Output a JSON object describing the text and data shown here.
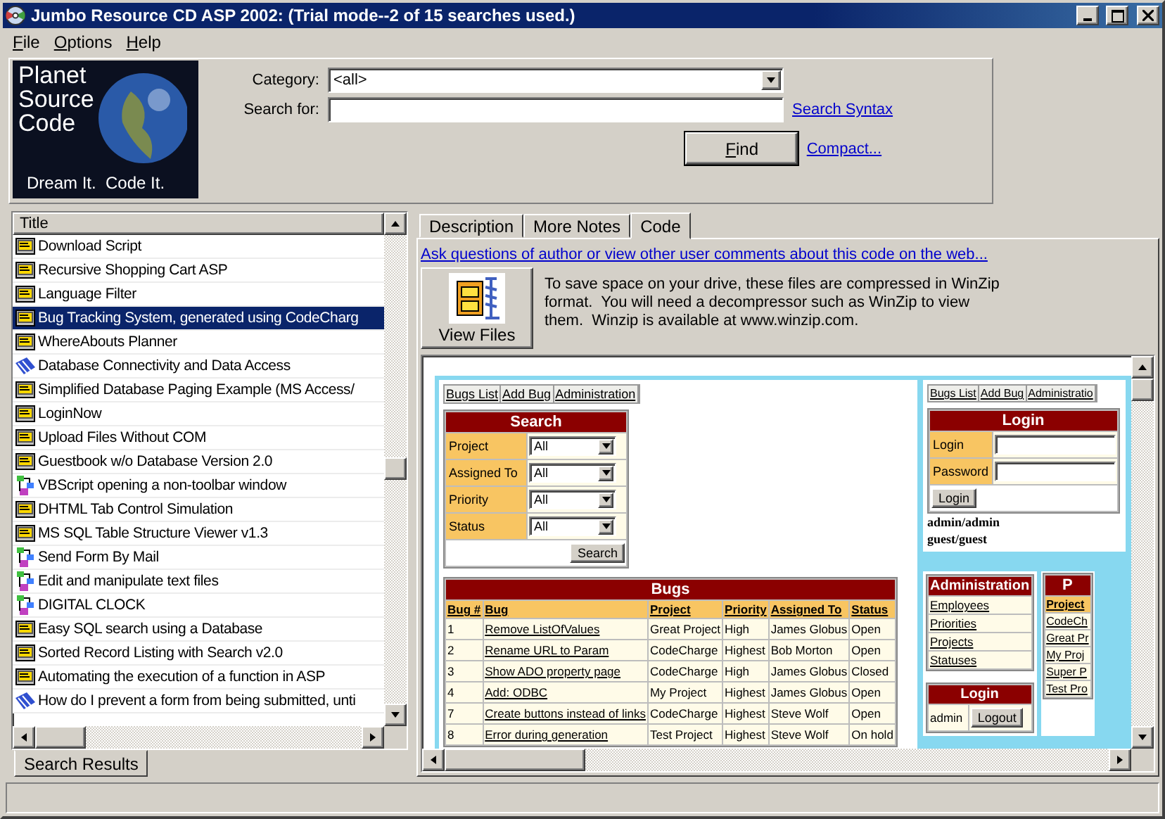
{
  "window": {
    "title": "Jumbo Resource CD ASP 2002: (Trial mode--2 of 15 searches used.)"
  },
  "menu": [
    {
      "label": "File"
    },
    {
      "label": "Options"
    },
    {
      "label": "Help"
    }
  ],
  "logo": {
    "lines": [
      "Planet",
      "Source",
      "Code"
    ],
    "tagline": "Dream It.  Code It."
  },
  "search": {
    "category_label": "Category:",
    "category_value": "<all>",
    "search_label": "Search for:",
    "syntax_link": "Search Syntax",
    "find_button": "Find",
    "compact_link": "Compact..."
  },
  "results": {
    "column": "Title",
    "items": [
      {
        "title": "Download Script",
        "kind": "sql",
        "selected": false
      },
      {
        "title": "Recursive Shopping Cart ASP",
        "kind": "sql",
        "selected": false
      },
      {
        "title": "Language Filter",
        "kind": "sql",
        "selected": false
      },
      {
        "title": "Bug Tracking System, generated using CodeCharg",
        "kind": "sql",
        "selected": true
      },
      {
        "title": "WhereAbouts Planner",
        "kind": "sql",
        "selected": false
      },
      {
        "title": "Database Connectivity and Data Access",
        "kind": "connect",
        "selected": false
      },
      {
        "title": "Simplified Database Paging Example (MS Access/",
        "kind": "sql",
        "selected": false
      },
      {
        "title": "LoginNow",
        "kind": "sql",
        "selected": false
      },
      {
        "title": "Upload Files Without COM",
        "kind": "sql",
        "selected": false
      },
      {
        "title": "Guestbook w/o Database Version 2.0",
        "kind": "sql",
        "selected": false
      },
      {
        "title": "VBScript opening a non-toolbar window",
        "kind": "diagram",
        "selected": false
      },
      {
        "title": "DHTML Tab Control Simulation",
        "kind": "sql",
        "selected": false
      },
      {
        "title": "MS SQL Table Structure Viewer v1.3",
        "kind": "sql",
        "selected": false
      },
      {
        "title": "Send Form By Mail",
        "kind": "diagram",
        "selected": false
      },
      {
        "title": "Edit and manipulate text files",
        "kind": "diagram",
        "selected": false
      },
      {
        "title": "DIGITAL CLOCK",
        "kind": "diagram",
        "selected": false
      },
      {
        "title": "Easy SQL search using a Database",
        "kind": "sql",
        "selected": false
      },
      {
        "title": "Sorted Record Listing with Search v2.0",
        "kind": "sql",
        "selected": false
      },
      {
        "title": "Automating the execution of a function in ASP",
        "kind": "sql",
        "selected": false
      },
      {
        "title": "How do I prevent a form from being submitted, unti",
        "kind": "connect",
        "selected": false
      }
    ]
  },
  "left_tabs": [
    {
      "label": "Search Results",
      "selected": true
    }
  ],
  "detail_tabs": [
    {
      "label": "Description",
      "selected": false
    },
    {
      "label": "More Notes",
      "selected": false
    },
    {
      "label": "Code",
      "selected": true
    }
  ],
  "web_link": "Ask questions of author or view other user comments about this code on the web...",
  "view_files_button": "View Files",
  "zip_note": "To save space on your drive, these files are compressed in WinZip format.  You will need a decompressor such as WinZip to view them.  Winzip is available at www.winzip.com.",
  "preview": {
    "nav": [
      "Bugs List",
      "Add Bug",
      "Administration"
    ],
    "search_form": {
      "title": "Search",
      "fields": [
        {
          "label": "Project",
          "value": "All"
        },
        {
          "label": "Assigned To",
          "value": "All"
        },
        {
          "label": "Priority",
          "value": "All"
        },
        {
          "label": "Status",
          "value": "All"
        }
      ],
      "button": "Search"
    },
    "bugs": {
      "title": "Bugs",
      "columns": [
        "Bug #",
        "Bug",
        "Project",
        "Priority",
        "Assigned To",
        "Status"
      ],
      "rows": [
        [
          "1",
          "Remove ListOfValues",
          "Great Project",
          "High",
          "James Globus",
          "Open"
        ],
        [
          "2",
          "Rename URL to Param",
          "CodeCharge",
          "Highest",
          "Bob Morton",
          "Open"
        ],
        [
          "3",
          "Show ADO property page",
          "CodeCharge",
          "High",
          "James Globus",
          "Closed"
        ],
        [
          "4",
          "Add: ODBC",
          "My Project",
          "Highest",
          "James Globus",
          "Open"
        ],
        [
          "7",
          "Create buttons instead of links",
          "CodeCharge",
          "Highest",
          "Steve Wolf",
          "Open"
        ],
        [
          "8",
          "Error during generation",
          "Test Project",
          "Highest",
          "Steve Wolf",
          "On hold"
        ]
      ]
    },
    "nav_right": [
      "Bugs List",
      "Add Bug",
      "Administratio"
    ],
    "login": {
      "title": "Login",
      "fields": [
        "Login",
        "Password"
      ],
      "button": "Login",
      "hints": [
        "admin/admin",
        "guest/guest"
      ]
    },
    "admin_menu": {
      "title": "Administration",
      "items": [
        "Employees",
        "Priorities",
        "Projects",
        "Statuses"
      ]
    },
    "session": {
      "title": "Login",
      "user": "admin",
      "button": "Logout"
    },
    "projects": {
      "title": "P",
      "header": "Project",
      "items": [
        "CodeCh",
        "Great Pr",
        "My Proj",
        "Super P",
        "Test Pro"
      ]
    }
  }
}
